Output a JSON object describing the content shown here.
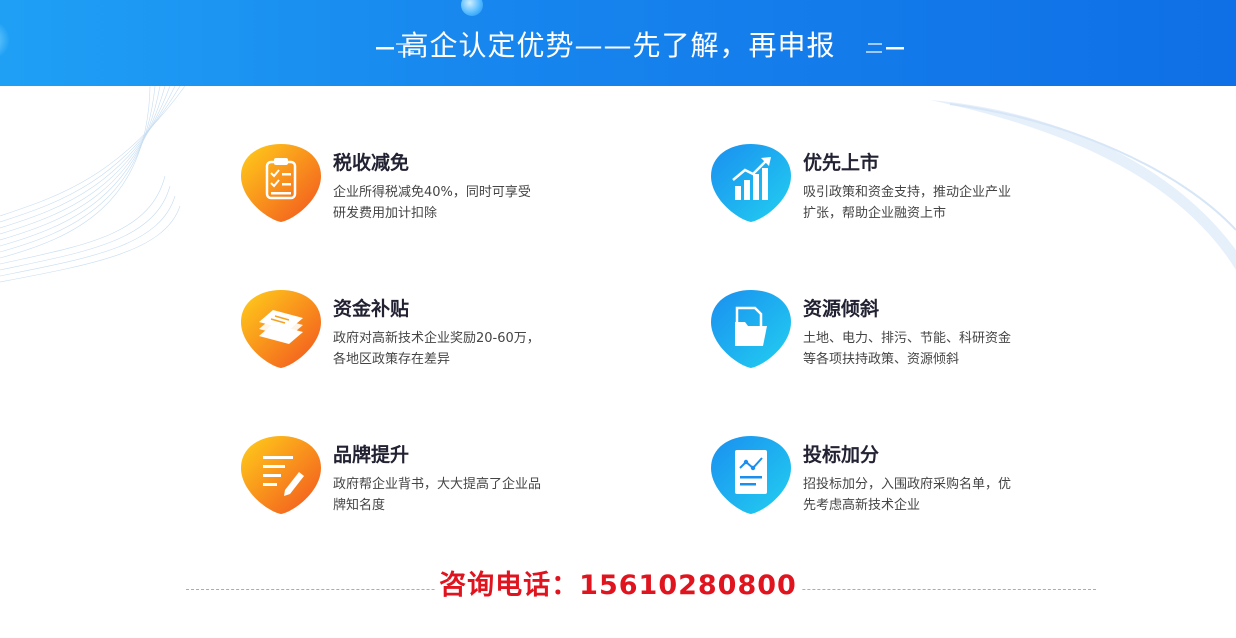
{
  "banner": {
    "title": "高企认定优势——先了解，再申报"
  },
  "items": [
    {
      "title": "税收减免",
      "desc": "企业所得税减免40%，同时可享受研发费用加计扣除",
      "icon": "checklist-icon",
      "theme": "orange"
    },
    {
      "title": "优先上市",
      "desc": "吸引政策和资金支持，推动企业产业扩张，帮助企业融资上市",
      "icon": "growth-chart-icon",
      "theme": "blue"
    },
    {
      "title": "资金补贴",
      "desc": "政府对高新技术企业奖励20-60万，各地区政策存在差异",
      "icon": "money-stack-icon",
      "theme": "orange"
    },
    {
      "title": "资源倾斜",
      "desc": "土地、电力、排污、节能、科研资金等各项扶持政策、资源倾斜",
      "icon": "folder-icon",
      "theme": "blue"
    },
    {
      "title": "品牌提升",
      "desc": "政府帮企业背书，大大提高了企业品牌知名度",
      "icon": "document-pen-icon",
      "theme": "orange"
    },
    {
      "title": "投标加分",
      "desc": "招投标加分，入围政府采购名单，优先考虑高新技术企业",
      "icon": "report-chart-icon",
      "theme": "blue"
    }
  ],
  "contact": {
    "phone_text": "咨询电话：15610280800"
  },
  "colors": {
    "banner": "#1786ee",
    "orange_start": "#ffcf1a",
    "orange_end": "#f2521f",
    "blue_start": "#1a8ff0",
    "blue_end": "#22d0f0",
    "phone": "#e0141e"
  }
}
